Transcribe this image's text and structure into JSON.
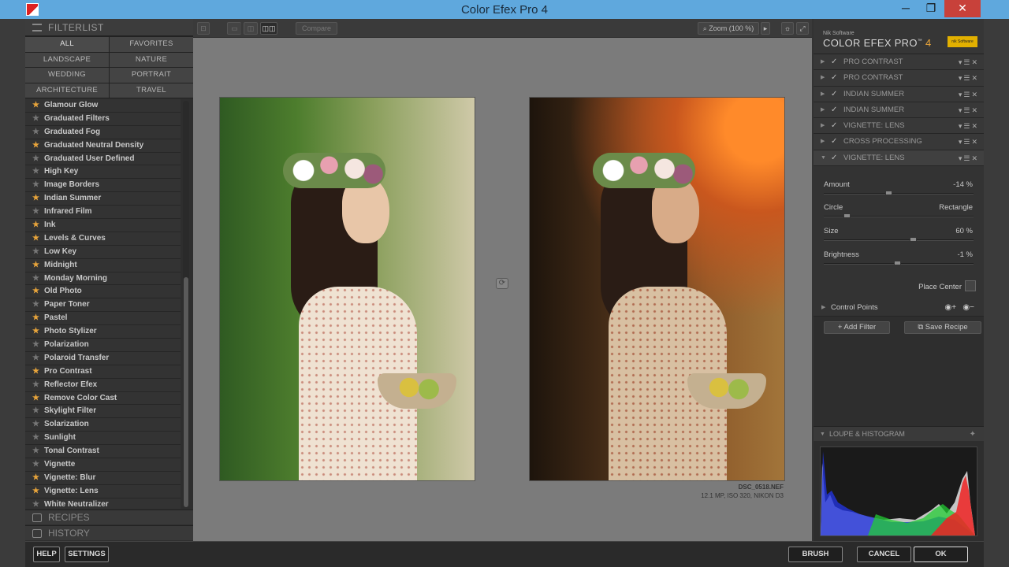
{
  "window": {
    "title": "Color Efex Pro 4",
    "minimize": "─",
    "maximize": "❐",
    "close": "✕"
  },
  "left": {
    "filterlist_title": "FILTERLIST",
    "categories": [
      "ALL",
      "FAVORITES",
      "LANDSCAPE",
      "NATURE",
      "WEDDING",
      "PORTRAIT",
      "ARCHITECTURE",
      "TRAVEL"
    ],
    "filters": [
      {
        "name": "Glamour Glow",
        "fav": true
      },
      {
        "name": "Graduated Filters",
        "fav": false
      },
      {
        "name": "Graduated Fog",
        "fav": false
      },
      {
        "name": "Graduated Neutral Density",
        "fav": true
      },
      {
        "name": "Graduated User Defined",
        "fav": false
      },
      {
        "name": "High Key",
        "fav": false
      },
      {
        "name": "Image Borders",
        "fav": false
      },
      {
        "name": "Indian Summer",
        "fav": true
      },
      {
        "name": "Infrared Film",
        "fav": false
      },
      {
        "name": "Ink",
        "fav": true
      },
      {
        "name": "Levels & Curves",
        "fav": true
      },
      {
        "name": "Low Key",
        "fav": false
      },
      {
        "name": "Midnight",
        "fav": true
      },
      {
        "name": "Monday Morning",
        "fav": false
      },
      {
        "name": "Old Photo",
        "fav": true
      },
      {
        "name": "Paper Toner",
        "fav": false
      },
      {
        "name": "Pastel",
        "fav": true
      },
      {
        "name": "Photo Stylizer",
        "fav": true
      },
      {
        "name": "Polarization",
        "fav": false
      },
      {
        "name": "Polaroid Transfer",
        "fav": false
      },
      {
        "name": "Pro Contrast",
        "fav": true
      },
      {
        "name": "Reflector Efex",
        "fav": false
      },
      {
        "name": "Remove Color Cast",
        "fav": true
      },
      {
        "name": "Skylight Filter",
        "fav": false
      },
      {
        "name": "Solarization",
        "fav": false
      },
      {
        "name": "Sunlight",
        "fav": false
      },
      {
        "name": "Tonal Contrast",
        "fav": false
      },
      {
        "name": "Vignette",
        "fav": false
      },
      {
        "name": "Vignette: Blur",
        "fav": true
      },
      {
        "name": "Vignette: Lens",
        "fav": true
      },
      {
        "name": "White Neutralizer",
        "fav": false
      }
    ],
    "recipes_title": "RECIPES",
    "history_title": "HISTORY"
  },
  "toolbar": {
    "compare_label": "Compare",
    "zoom_label": "Zoom (100 %)"
  },
  "canvas": {
    "filename": "DSC_0518.NEF",
    "info": "12.1 MP, ISO 320, NIKON D3"
  },
  "right": {
    "brand_small": "Nik Software",
    "brand_name": "COLOR EFEX PRO",
    "brand_tm": "™",
    "brand_version": "4",
    "logo_text": "nik Software",
    "stack": [
      "PRO CONTRAST",
      "PRO CONTRAST",
      "INDIAN SUMMER",
      "INDIAN SUMMER",
      "VIGNETTE: LENS",
      "CROSS PROCESSING",
      "VIGNETTE: LENS"
    ],
    "controls": {
      "amount_label": "Amount",
      "amount_value": "-14 %",
      "amount_level": 0.43,
      "circle_label": "Circle",
      "rect_label": "Rectangle",
      "shape_level": 0.14,
      "size_label": "Size",
      "size_value": "60 %",
      "size_level": 0.6,
      "brightness_label": "Brightness",
      "brightness_value": "-1 %",
      "brightness_level": 0.49,
      "place_center": "Place Center"
    },
    "control_points": "Control Points",
    "add_filter": "Add Filter",
    "save_recipe": "Save Recipe",
    "loupe_title": "LOUPE & HISTOGRAM"
  },
  "footer": {
    "help": "HELP",
    "settings": "SETTINGS",
    "brush": "BRUSH",
    "cancel": "CANCEL",
    "ok": "OK"
  }
}
